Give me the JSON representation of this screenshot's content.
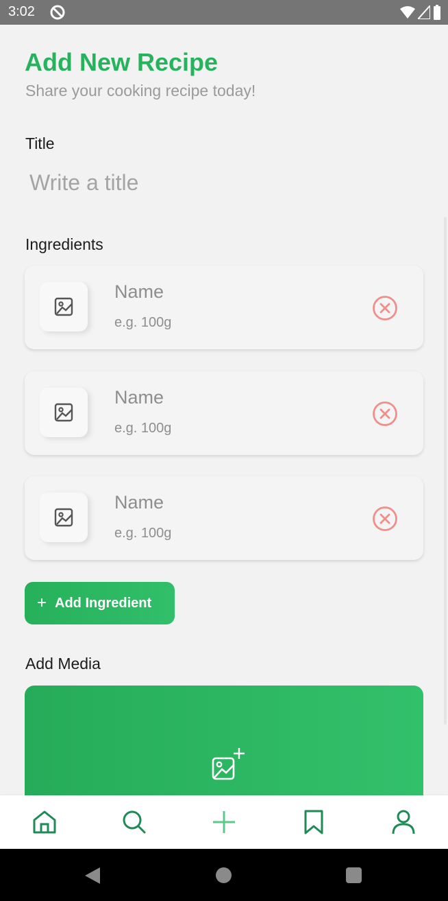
{
  "status_bar": {
    "time": "3:02"
  },
  "header": {
    "title": "Add New Recipe",
    "subtitle": "Share your cooking recipe today!"
  },
  "form": {
    "title_label": "Title",
    "title_placeholder": "Write a title",
    "ingredients_label": "Ingredients",
    "ingredients": [
      {
        "name_placeholder": "Name",
        "quantity_placeholder": "e.g. 100g"
      },
      {
        "name_placeholder": "Name",
        "quantity_placeholder": "e.g. 100g"
      },
      {
        "name_placeholder": "Name",
        "quantity_placeholder": "e.g. 100g"
      }
    ],
    "add_ingredient_plus": "+",
    "add_ingredient_label": "Add Ingredient",
    "media_label": "Add Media"
  },
  "bottom_nav": {
    "items": [
      {
        "icon": "home-icon",
        "active": false
      },
      {
        "icon": "search-icon",
        "active": false
      },
      {
        "icon": "plus-icon",
        "active": true
      },
      {
        "icon": "bookmark-icon",
        "active": false
      },
      {
        "icon": "profile-icon",
        "active": false
      }
    ]
  },
  "colors": {
    "accent": "#27b35e",
    "nav_icon": "#1f8a55",
    "remove_icon": "#ef8f8a",
    "status_bar": "#757575"
  }
}
